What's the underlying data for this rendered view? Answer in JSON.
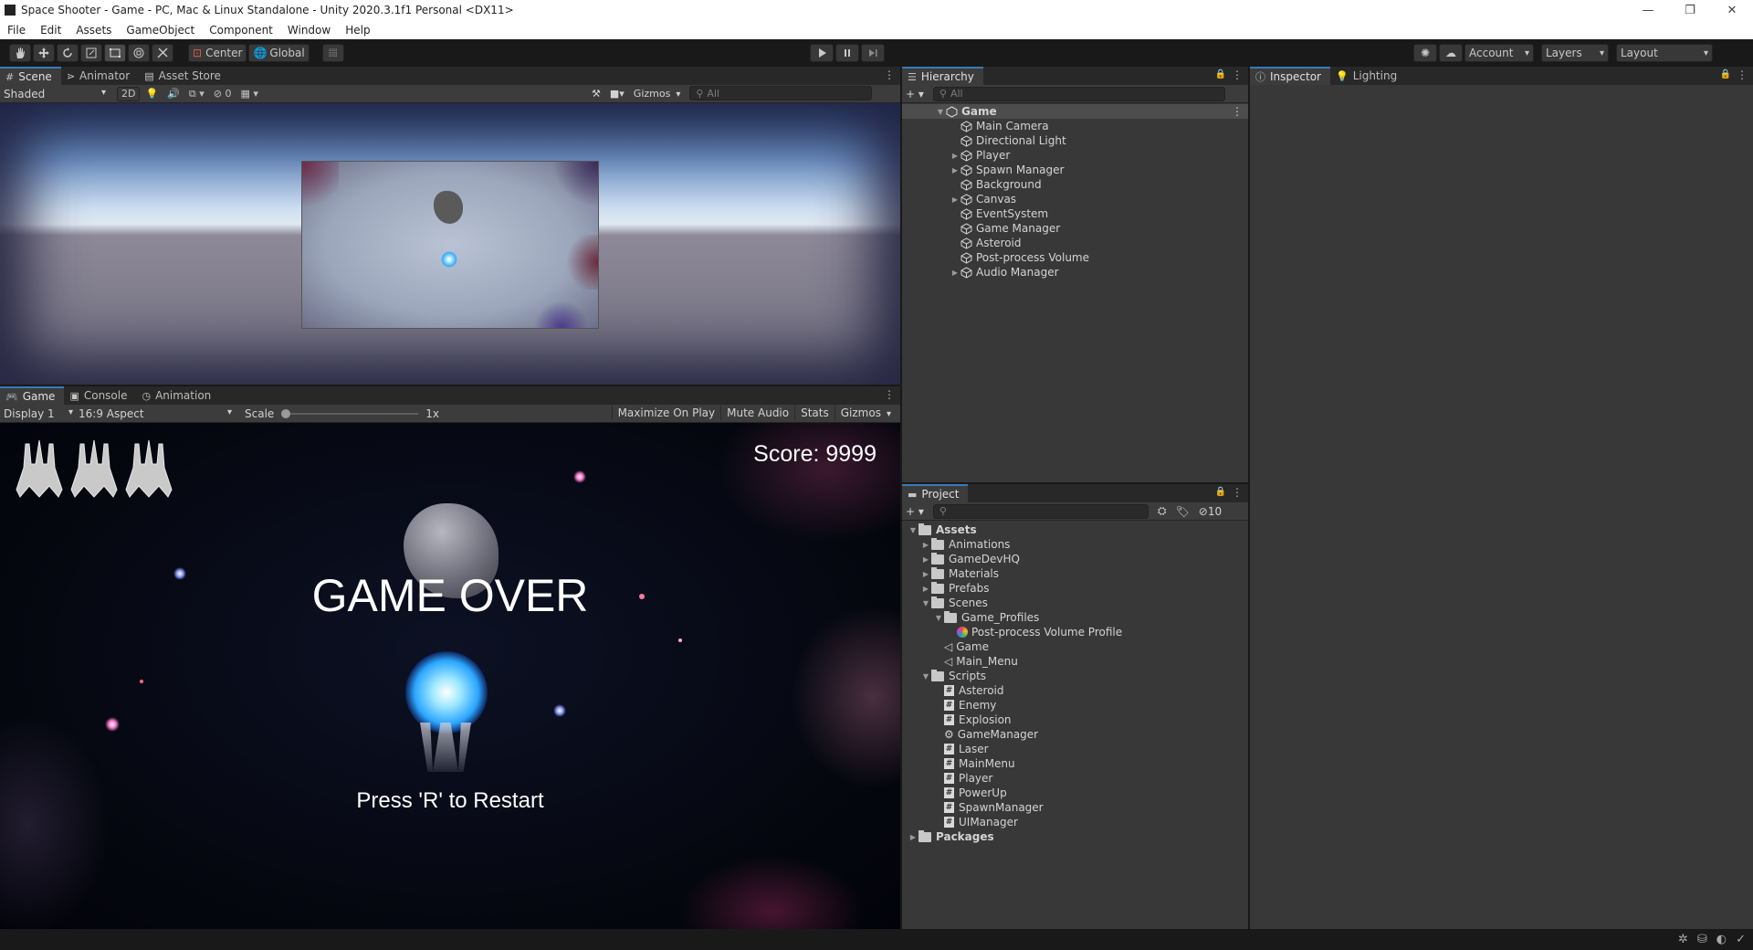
{
  "window": {
    "title": "Space Shooter - Game - PC, Mac & Linux Standalone - Unity 2020.3.1f1 Personal <DX11>"
  },
  "menu": [
    "File",
    "Edit",
    "Assets",
    "GameObject",
    "Component",
    "Window",
    "Help"
  ],
  "toolbar": {
    "pivot": "Center",
    "space": "Global",
    "account": "Account",
    "layers": "Layers",
    "layout": "Layout"
  },
  "scene": {
    "tabs": [
      "Scene",
      "Animator",
      "Asset Store"
    ],
    "shading": "Shaded",
    "mode_2d": "2D",
    "hidden_count": "0",
    "gizmos": "Gizmos",
    "search_placeholder": "All"
  },
  "game": {
    "tabs": [
      "Game",
      "Console",
      "Animation"
    ],
    "display": "Display 1",
    "aspect": "16:9 Aspect",
    "scale_label": "Scale",
    "scale_value": "1x",
    "scale_level": 0.0,
    "maximize": "Maximize On Play",
    "mute": "Mute Audio",
    "stats": "Stats",
    "gizmos": "Gizmos",
    "score": "Score: 9999",
    "game_over": "GAME OVER",
    "restart": "Press 'R' to Restart",
    "lives": 3
  },
  "hierarchy": {
    "tab": "Hierarchy",
    "search_placeholder": "All",
    "root": "Game",
    "items": [
      {
        "label": "Main Camera",
        "expandable": false
      },
      {
        "label": "Directional Light",
        "expandable": false
      },
      {
        "label": "Player",
        "expandable": true
      },
      {
        "label": "Spawn Manager",
        "expandable": true
      },
      {
        "label": "Background",
        "expandable": false
      },
      {
        "label": "Canvas",
        "expandable": true
      },
      {
        "label": "EventSystem",
        "expandable": false
      },
      {
        "label": "Game Manager",
        "expandable": false
      },
      {
        "label": "Asteroid",
        "expandable": false
      },
      {
        "label": "Post-process Volume",
        "expandable": false
      },
      {
        "label": "Audio Manager",
        "expandable": true
      }
    ]
  },
  "inspector": {
    "tabs": [
      "Inspector",
      "Lighting"
    ]
  },
  "project": {
    "tab": "Project",
    "hidden_count": "10",
    "tree": [
      {
        "label": "Assets",
        "level": 0,
        "kind": "folder",
        "arrow": "▼",
        "bold": true
      },
      {
        "label": "Animations",
        "level": 1,
        "kind": "folder",
        "arrow": "▶"
      },
      {
        "label": "GameDevHQ",
        "level": 1,
        "kind": "folder",
        "arrow": "▶"
      },
      {
        "label": "Materials",
        "level": 1,
        "kind": "folder",
        "arrow": "▶"
      },
      {
        "label": "Prefabs",
        "level": 1,
        "kind": "folder",
        "arrow": "▶"
      },
      {
        "label": "Scenes",
        "level": 1,
        "kind": "folder",
        "arrow": "▼"
      },
      {
        "label": "Game_Profiles",
        "level": 2,
        "kind": "folder",
        "arrow": "▼"
      },
      {
        "label": "Post-process Volume Profile",
        "level": 3,
        "kind": "profile",
        "arrow": ""
      },
      {
        "label": "Game",
        "level": 2,
        "kind": "scene",
        "arrow": ""
      },
      {
        "label": "Main_Menu",
        "level": 2,
        "kind": "scene",
        "arrow": ""
      },
      {
        "label": "Scripts",
        "level": 1,
        "kind": "folder",
        "arrow": "▼"
      },
      {
        "label": "Asteroid",
        "level": 2,
        "kind": "script",
        "arrow": ""
      },
      {
        "label": "Enemy",
        "level": 2,
        "kind": "script",
        "arrow": ""
      },
      {
        "label": "Explosion",
        "level": 2,
        "kind": "script",
        "arrow": ""
      },
      {
        "label": "GameManager",
        "level": 2,
        "kind": "gear",
        "arrow": ""
      },
      {
        "label": "Laser",
        "level": 2,
        "kind": "script",
        "arrow": ""
      },
      {
        "label": "MainMenu",
        "level": 2,
        "kind": "script",
        "arrow": ""
      },
      {
        "label": "Player",
        "level": 2,
        "kind": "script",
        "arrow": ""
      },
      {
        "label": "PowerUp",
        "level": 2,
        "kind": "script",
        "arrow": ""
      },
      {
        "label": "SpawnManager",
        "level": 2,
        "kind": "script",
        "arrow": ""
      },
      {
        "label": "UIManager",
        "level": 2,
        "kind": "script",
        "arrow": ""
      },
      {
        "label": "Packages",
        "level": 0,
        "kind": "folder",
        "arrow": "▶",
        "bold": true
      }
    ]
  },
  "colors": {
    "accent": "#3a79bb",
    "panel": "#383838",
    "tab_bar": "#282828",
    "toolbar": "#191919"
  }
}
